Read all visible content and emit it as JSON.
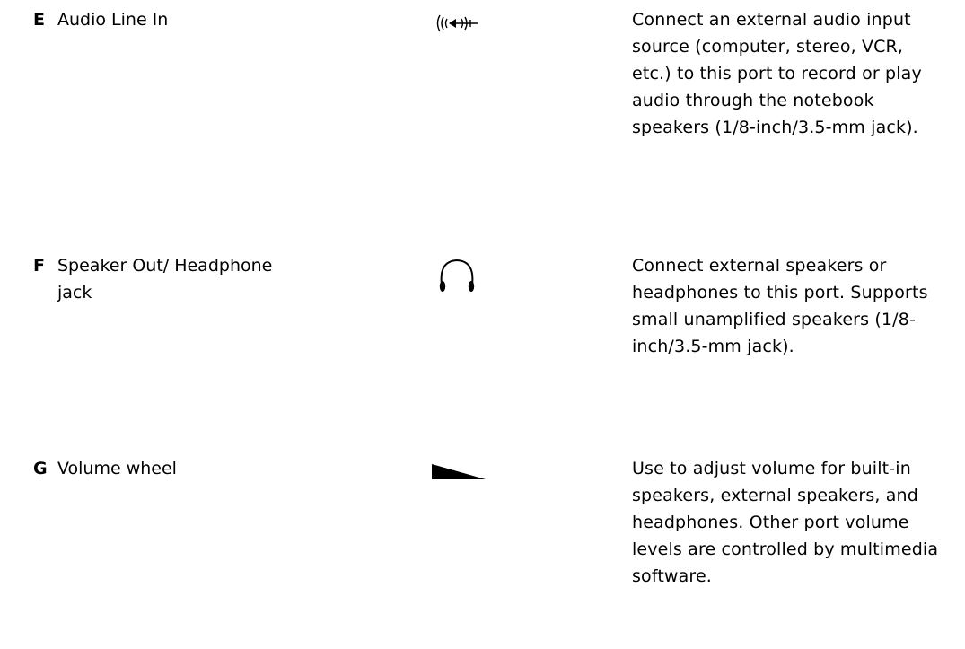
{
  "rows": [
    {
      "letter": "E",
      "name": "Audio Line In",
      "icon": "audio-line-in-icon",
      "description": "Connect an external audio input source (computer, stereo, VCR, etc.) to this port to record or play audio through the notebook speakers (1/8-inch/3.5-mm jack)."
    },
    {
      "letter": "F",
      "name": "Speaker Out/ Headphone jack",
      "icon": "headphone-icon",
      "description": "Connect external speakers or headphones to this port. Supports small unamplified speakers (1/8-inch/3.5-mm jack)."
    },
    {
      "letter": "G",
      "name": "Volume wheel",
      "icon": "volume-wedge-icon",
      "description": "Use to adjust volume for built-in speakers, external speakers, and headphones. Other port volume levels are controlled by multimedia software."
    }
  ]
}
